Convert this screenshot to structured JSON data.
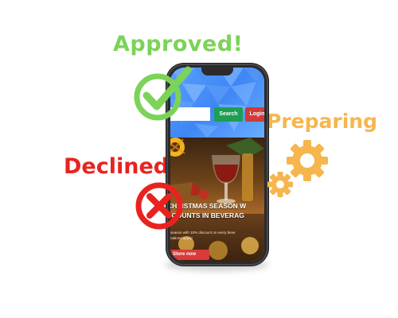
{
  "labels": {
    "approved": "Approved!",
    "preparing": "Preparing",
    "declined": "Declined!"
  },
  "phone": {
    "header": {
      "search_placeholder": "",
      "search_button": "Search",
      "login_button": "Login"
    },
    "hero": {
      "title": "CHRISTMAS SEASON W\nSCOUNTS IN BEVERAG",
      "text": "season with 10% discount on every beve\nnations apply!",
      "button": "Store now"
    }
  },
  "icons": {
    "approved": "check-circle-icon",
    "preparing": "gears-icon",
    "declined": "x-circle-icon"
  },
  "colors": {
    "approved": "#7bd357",
    "preparing": "#f6b64d",
    "declined": "#e8231f",
    "header_blue": "#3f86f5",
    "search_green": "#1e9e52",
    "login_red": "#d03a3a"
  }
}
